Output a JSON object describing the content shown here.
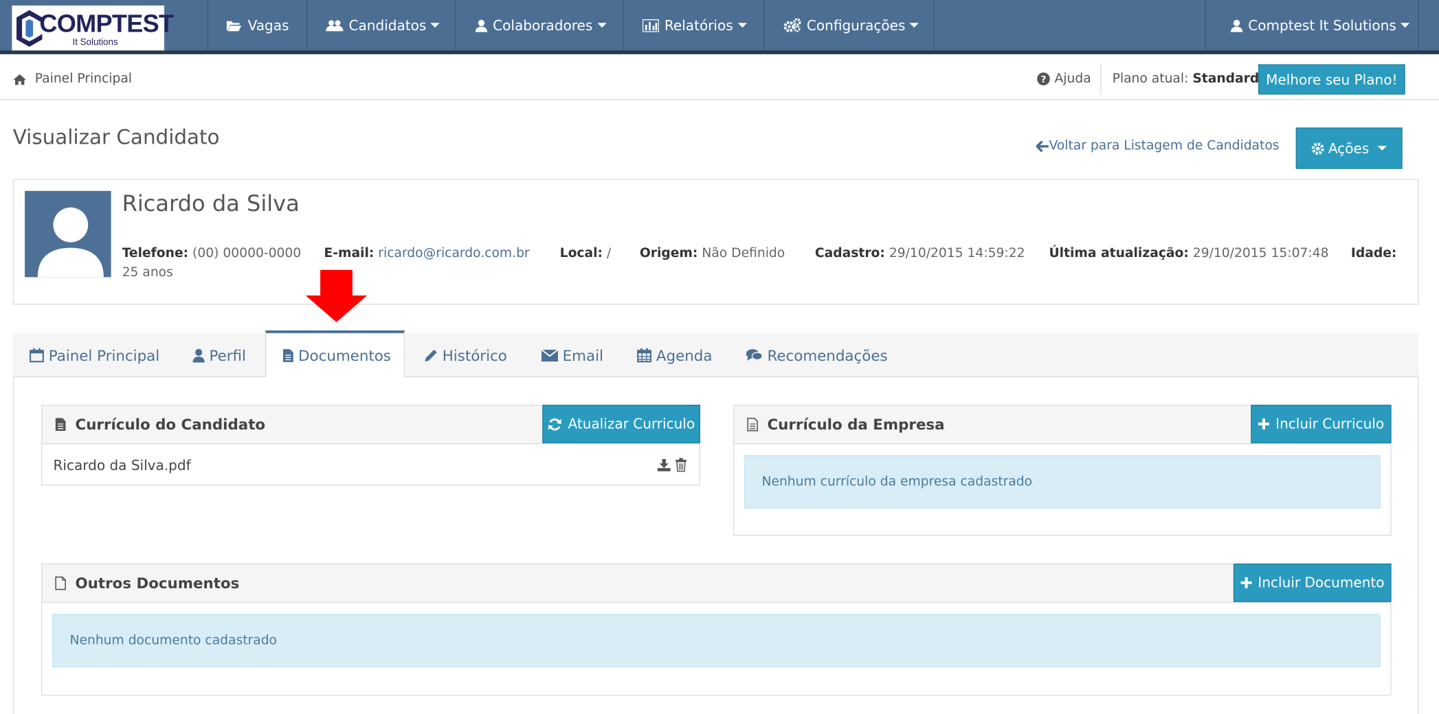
{
  "brand": {
    "logo_word": "COMPTEST",
    "logo_sub": "It Solutions"
  },
  "nav": {
    "vagas": "Vagas",
    "candidatos": "Candidatos",
    "colaboradores": "Colaboradores",
    "relatorios": "Relatórios",
    "configuracoes": "Configurações",
    "account": "Comptest It Solutions"
  },
  "breadcrumb": {
    "home": "Painel Principal",
    "help": "Ajuda",
    "plan_label": "Plano atual:",
    "plan_value": "Standard",
    "upgrade": "Melhore seu Plano!"
  },
  "page": {
    "title": "Visualizar Candidato",
    "back_link": "Voltar para Listagem de Candidatos",
    "actions": "Ações"
  },
  "candidate": {
    "name": "Ricardo da Silva",
    "phone_label": "Telefone:",
    "phone": "(00) 00000-0000",
    "email_label": "E-mail:",
    "email": "ricardo@ricardo.com.br",
    "local_label": "Local:",
    "local": "/",
    "origin_label": "Origem:",
    "origin": "Não Definido",
    "created_label": "Cadastro:",
    "created": "29/10/2015 14:59:22",
    "updated_label": "Última atualização:",
    "updated": "29/10/2015 15:07:48",
    "age_label": "Idade:",
    "age": "25 anos"
  },
  "tabs": [
    {
      "label": "Painel Principal",
      "icon": "calendar-icon"
    },
    {
      "label": "Perfil",
      "icon": "user-icon"
    },
    {
      "label": "Documentos",
      "icon": "file-icon",
      "active": true
    },
    {
      "label": "Histórico",
      "icon": "pencil-icon"
    },
    {
      "label": "Email",
      "icon": "envelope-icon"
    },
    {
      "label": "Agenda",
      "icon": "calendar-grid-icon"
    },
    {
      "label": "Recomendações",
      "icon": "comments-icon"
    }
  ],
  "cv_candidate": {
    "title": "Currículo do Candidato",
    "button": "Atualizar Curriculo",
    "file": "Ricardo da Silva.pdf"
  },
  "cv_company": {
    "title": "Currículo da Empresa",
    "button": "Incluir Curriculo",
    "empty": "Nenhum currículo da empresa cadastrado"
  },
  "other_docs": {
    "title": "Outros Documentos",
    "button": "Incluir Documento",
    "empty": "Nenhum documento cadastrado"
  },
  "colors": {
    "nav_bg": "#4c6e93",
    "accent": "#2a9bbf",
    "link": "#4a6f95",
    "alert_bg": "#d9edf7",
    "arrow": "#ff0000"
  }
}
